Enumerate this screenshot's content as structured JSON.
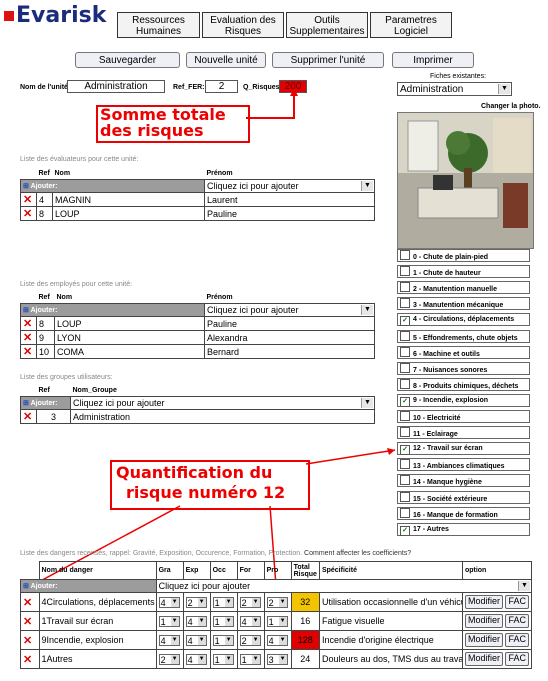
{
  "app": {
    "logo": "Evarisk"
  },
  "nav": [
    {
      "l1": "Ressources",
      "l2": "Humaines"
    },
    {
      "l1": "Evaluation des",
      "l2": "Risques"
    },
    {
      "l1": "Outils",
      "l2": "Supplementaires"
    },
    {
      "l1": "Parametres",
      "l2": "Logiciel"
    }
  ],
  "actions": {
    "save": "Sauvegarder",
    "new_unit": "Nouvelle unité",
    "delete_unit": "Supprimer l'unité",
    "print": "Imprimer"
  },
  "unit": {
    "name_label": "Nom de l'unité:",
    "name": "Administration",
    "ref_label": "Ref_FER:",
    "ref": "2",
    "q_label": "Q_Risques:",
    "q": "200",
    "existing_label": "Fiches existantes:",
    "existing": "Administration",
    "change_photo": "Changer la photo."
  },
  "annotations": {
    "total_l1": "Somme totale",
    "total_l2": "des risques",
    "quant_l1": "Quantification du",
    "quant_l2": "risque numéro 12"
  },
  "evaluators": {
    "title": "Liste des évaluateurs pour cette unité:",
    "headers": [
      "Ref",
      "Nom",
      "Prénom"
    ],
    "add_label": "Ajouter:",
    "add_placeholder": "Cliquez ici pour ajouter",
    "rows": [
      {
        "ref": "4",
        "nom": "MAGNIN",
        "prenom": "Laurent"
      },
      {
        "ref": "8",
        "nom": "LOUP",
        "prenom": "Pauline"
      }
    ]
  },
  "employees": {
    "title": "Liste des employés pour cette unité:",
    "headers": [
      "Ref",
      "Nom",
      "Prénom"
    ],
    "add_label": "Ajouter:",
    "add_placeholder": "Cliquez ici pour ajouter",
    "rows": [
      {
        "ref": "8",
        "nom": "LOUP",
        "prenom": "Pauline"
      },
      {
        "ref": "9",
        "nom": "LYON",
        "prenom": "Alexandra"
      },
      {
        "ref": "10",
        "nom": "COMA",
        "prenom": "Bernard"
      }
    ]
  },
  "groups": {
    "title": "Liste des groupes utilisateurs:",
    "headers": [
      "Ref",
      "Nom_Groupe"
    ],
    "add_label": "Ajouter:",
    "add_placeholder": "Cliquez ici pour ajouter",
    "rows": [
      {
        "ref": "3",
        "nom": "Administration"
      }
    ]
  },
  "risks": [
    {
      "label": "0 - Chute de plain-pied",
      "checked": false
    },
    {
      "label": "1 - Chute de hauteur",
      "checked": false
    },
    {
      "label": "2 - Manutention manuelle",
      "checked": false
    },
    {
      "label": "3 - Manutention mécanique",
      "checked": false
    },
    {
      "label": "4 - Circulations, déplacements",
      "checked": true
    },
    {
      "label": "5 - Effondrements, chute objets",
      "checked": false
    },
    {
      "label": "6 - Machine et outils",
      "checked": false
    },
    {
      "label": "7 - Nuisances sonores",
      "checked": false
    },
    {
      "label": "8 - Produits chimiques, déchets",
      "checked": false
    },
    {
      "label": "9 - Incendie, explosion",
      "checked": true
    },
    {
      "label": "10 - Electricité",
      "checked": false
    },
    {
      "label": "11 - Eclairage",
      "checked": false
    },
    {
      "label": "12 - Travail sur écran",
      "checked": true
    },
    {
      "label": "13 - Ambiances climatiques",
      "checked": false
    },
    {
      "label": "14 - Manque hygiène",
      "checked": false
    },
    {
      "label": "15 - Société extérieure",
      "checked": false
    },
    {
      "label": "16 - Manque de formation",
      "checked": false
    },
    {
      "label": "17 - Autres",
      "checked": true
    }
  ],
  "dangers": {
    "title": "Liste des dangers recensés, rappel: Gravité, Exposition, Occurence, Formation, Protection.",
    "link": "Comment affecter les coefficients?",
    "headers": {
      "nom": "Nom du danger",
      "gra": "Gra",
      "exp": "Exp",
      "occ": "Occ",
      "for": "For",
      "pro": "Pro",
      "total1": "Total",
      "total2": "Risque",
      "spec": "Spécificité",
      "option": "option"
    },
    "add_label": "Ajouter:",
    "add_placeholder": "Cliquez ici pour ajouter",
    "modify": "Modifier",
    "fac": "FAC",
    "rows": [
      {
        "num": "4",
        "nom": "Circulations, déplacements",
        "gra": "4",
        "exp": "2",
        "occ": "1",
        "for": "2",
        "pro": "2",
        "total": "32",
        "color": "#f5c400",
        "spec": "Utilisation occasionnelle d'un véhicule : m"
      },
      {
        "num": "1",
        "nom": "Travail sur écran",
        "gra": "1",
        "exp": "4",
        "occ": "1",
        "for": "4",
        "pro": "1",
        "total": "16",
        "color": "#ffffff",
        "spec": "Fatigue visuelle"
      },
      {
        "num": "9",
        "nom": "Incendie, explosion",
        "gra": "4",
        "exp": "4",
        "occ": "1",
        "for": "2",
        "pro": "4",
        "total": "128",
        "color": "#e00000",
        "spec": "Incendie d'origine électrique"
      },
      {
        "num": "1",
        "nom": "Autres",
        "gra": "2",
        "exp": "4",
        "occ": "1",
        "for": "1",
        "pro": "3",
        "total": "24",
        "color": "#ffffff",
        "spec": "Douleurs au dos, TMS dus au travail sur"
      }
    ]
  }
}
